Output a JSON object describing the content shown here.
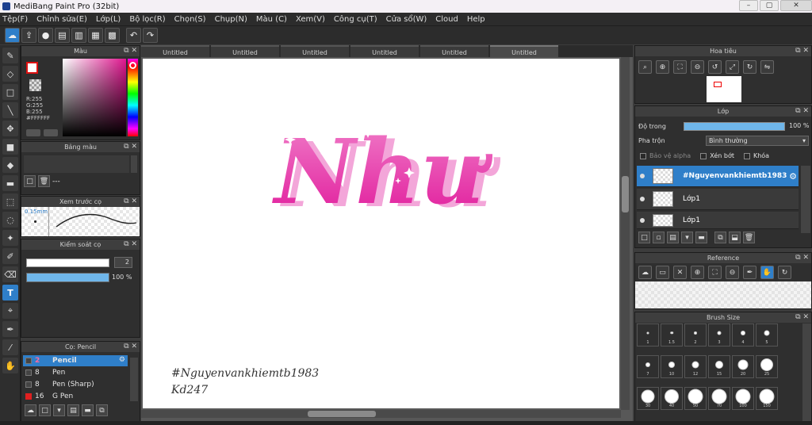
{
  "window": {
    "title": "MediBang Paint Pro (32bit)",
    "buttons": [
      "–",
      "▢",
      "✕"
    ]
  },
  "menu": [
    "Tệp(F)",
    "Chỉnh sửa(E)",
    "Lớp(L)",
    "Bộ lọc(R)",
    "Chọn(S)",
    "Chụp(N)",
    "Màu (C)",
    "Xem(V)",
    "Công cụ(T)",
    "Cửa sổ(W)",
    "Cloud",
    "Help"
  ],
  "toolbar": {
    "icons": [
      "cloud-icon",
      "share-icon",
      "chat-icon",
      "document-icon",
      "page-icon",
      "grid-icon",
      "panels-icon",
      "undo-icon",
      "redo-icon"
    ]
  },
  "left_tools": [
    "brush-icon",
    "eraser-icon",
    "rectangle-icon",
    "pen-icon",
    "move-icon",
    "fill-rect-icon",
    "bucket-icon",
    "gradient-icon",
    "select-rect-icon",
    "lasso-icon",
    "magic-wand-icon",
    "select-pen-icon",
    "select-eraser-icon",
    "text-icon",
    "operation-icon",
    "dropper-icon",
    "eyedropper-icon",
    "hand-icon"
  ],
  "color_panel": {
    "title": "Màu",
    "rgb": [
      "R:255",
      "G:255",
      "B:255",
      "#FFFFFF"
    ],
    "accent": "#e0168f"
  },
  "palette_panel": {
    "title": "Bảng màu",
    "empty_text": "---"
  },
  "preview_panel": {
    "title": "Xem trước cọ",
    "size": "0.15mm"
  },
  "control_panel": {
    "title": "Kiểm soát cọ",
    "size_value": "2",
    "opacity": 100,
    "opacity_label": "100 %"
  },
  "brush_panel": {
    "title": "Cọ: Pencil",
    "brushes": [
      {
        "size": "2",
        "name": "Pencil",
        "selected": true,
        "color": "#333333"
      },
      {
        "size": "8",
        "name": "Pen",
        "selected": false,
        "color": "#333333"
      },
      {
        "size": "8",
        "name": "Pen (Sharp)",
        "selected": false,
        "color": "#333333"
      },
      {
        "size": "16",
        "name": "G Pen",
        "selected": false,
        "color": "#e02020"
      }
    ]
  },
  "tabs": [
    "Untitled",
    "Untitled",
    "Untitled",
    "Untitled",
    "Untitled",
    "Untitled"
  ],
  "canvas": {
    "art_text": "Như",
    "art_color": "#ea3ea8",
    "signature_line1": "#Nguyenvankhiemtb1983",
    "signature_line2": "Kd247"
  },
  "nav_panel": {
    "title": "Hoa tiêu"
  },
  "layer_panel": {
    "title": "Lớp",
    "opacity_label": "Độ trong",
    "opacity_value": "100 %",
    "blend_label": "Pha trộn",
    "blend_value": "Bình thường",
    "protect_alpha": "Bảo vệ alpha",
    "clipping": "Xén bớt",
    "lock": "Khóa",
    "layers": [
      {
        "name": "#Nguyenvankhiemtb1983",
        "selected": true
      },
      {
        "name": "Lớp1",
        "selected": false
      },
      {
        "name": "Lớp1",
        "selected": false
      }
    ]
  },
  "reference_panel": {
    "title": "Reference"
  },
  "brush_size_panel": {
    "title": "Brush Size",
    "sizes": [
      "1",
      "1.5",
      "2",
      "3",
      "4",
      "5",
      "7",
      "10",
      "12",
      "15",
      "20",
      "25",
      "30",
      "40",
      "50",
      "70",
      "100",
      "150"
    ]
  }
}
